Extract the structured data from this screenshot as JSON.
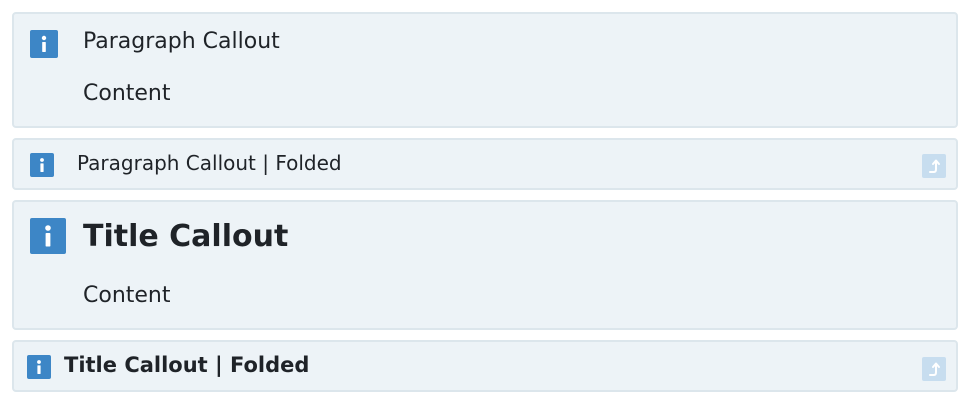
{
  "callouts": [
    {
      "kind": "paragraph",
      "title": "Paragraph Callout",
      "content": "Content",
      "icon": "info-icon",
      "folded": false
    },
    {
      "kind": "paragraph",
      "title": "Paragraph Callout | Folded",
      "icon": "info-icon",
      "folded": true,
      "unfold_icon": "unfold-arrow-icon"
    },
    {
      "kind": "title",
      "title": "Title Callout",
      "content": "Content",
      "icon": "info-icon",
      "folded": false
    },
    {
      "kind": "title",
      "title": "Title Callout | Folded",
      "icon": "info-icon",
      "folded": true,
      "unfold_icon": "unfold-arrow-icon"
    }
  ],
  "colors": {
    "callout_background": "#edf3f7",
    "callout_border": "#dce6ec",
    "icon_background": "#3d86c6",
    "unfold_button_background": "#c7ddef",
    "text": "#1f2328"
  }
}
